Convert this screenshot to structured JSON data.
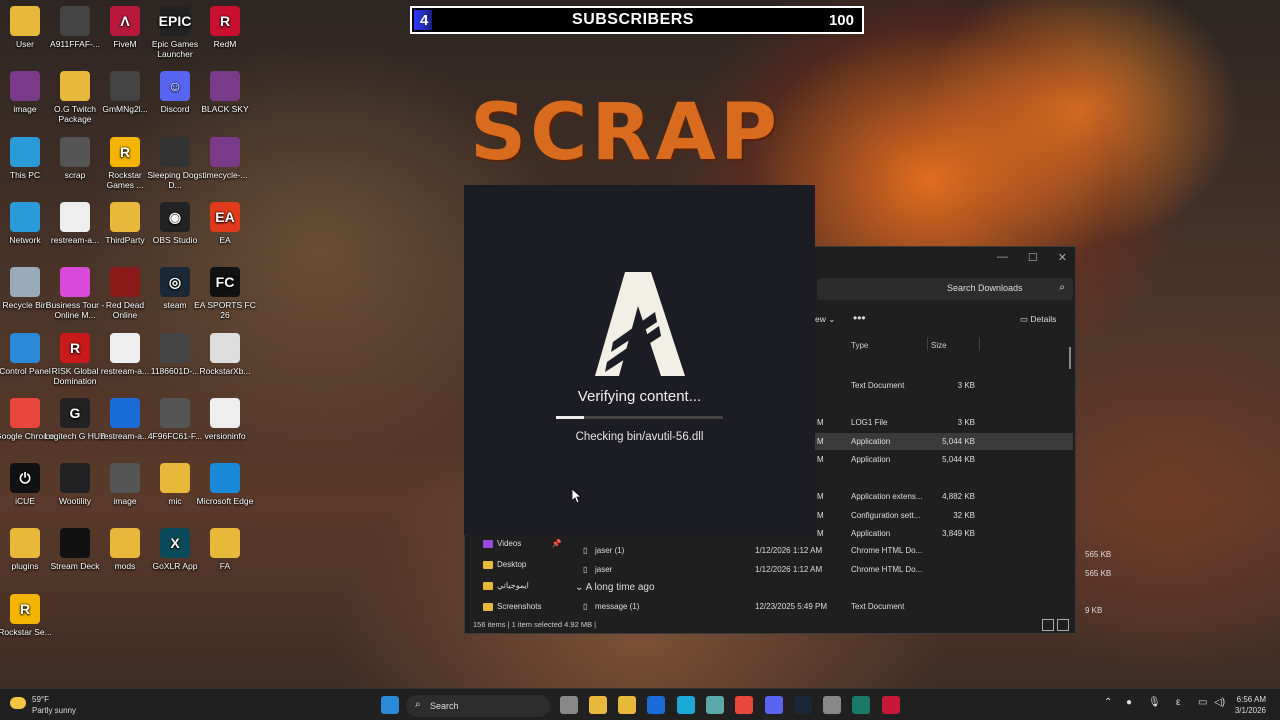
{
  "overlay": {
    "current": "4",
    "label": "SUBSCRIBERS",
    "goal": "100",
    "progress_fraction": 0.04,
    "bg_title": "SCRAP"
  },
  "desktop_icons": [
    {
      "label": "User",
      "color": "#e8b83a",
      "glyph": ""
    },
    {
      "label": "A911FFAF-...",
      "color": "#444",
      "glyph": ""
    },
    {
      "label": "FiveM",
      "color": "#b8183a",
      "glyph": "Λ"
    },
    {
      "label": "Epic Games Launcher",
      "color": "#222",
      "glyph": "EPIC"
    },
    {
      "label": "RedM",
      "color": "#c8102e",
      "glyph": "R"
    },
    {
      "label": "image",
      "color": "#7a3a8a",
      "glyph": ""
    },
    {
      "label": "O.G Twitch Package",
      "color": "#e8b83a",
      "glyph": ""
    },
    {
      "label": "GmMNg2l...",
      "color": "#444",
      "glyph": ""
    },
    {
      "label": "Discord",
      "color": "#5865f2",
      "glyph": "☺"
    },
    {
      "label": "BLACK SKY",
      "color": "#7a3a8a",
      "glyph": ""
    },
    {
      "label": "This PC",
      "color": "#2a9ad8",
      "glyph": ""
    },
    {
      "label": "scrap",
      "color": "#555",
      "glyph": ""
    },
    {
      "label": "Rockstar Games ...",
      "color": "#f4b400",
      "glyph": "R"
    },
    {
      "label": "Sleeping Dogs D...",
      "color": "#333",
      "glyph": ""
    },
    {
      "label": "timecycle-...",
      "color": "#7a3a8a",
      "glyph": ""
    },
    {
      "label": "Network",
      "color": "#2a9ad8",
      "glyph": ""
    },
    {
      "label": "restream-a...",
      "color": "#eee",
      "glyph": ""
    },
    {
      "label": "ThirdParty",
      "color": "#e8b83a",
      "glyph": ""
    },
    {
      "label": "OBS Studio",
      "color": "#222",
      "glyph": "◉"
    },
    {
      "label": "EA",
      "color": "#e03a1a",
      "glyph": "EA"
    },
    {
      "label": "Recycle Bin",
      "color": "#9ab",
      "glyph": ""
    },
    {
      "label": "Business Tour - Online M...",
      "color": "#d84ad8",
      "glyph": ""
    },
    {
      "label": "Red Dead Online",
      "color": "#8a1a1a",
      "glyph": ""
    },
    {
      "label": "steam",
      "color": "#1b2838",
      "glyph": "◎"
    },
    {
      "label": "EA SPORTS FC 26",
      "color": "#111",
      "glyph": "FC"
    },
    {
      "label": "Control Panel",
      "color": "#2a8ad8",
      "glyph": ""
    },
    {
      "label": "RISK Global Domination",
      "color": "#c81a1a",
      "glyph": "R"
    },
    {
      "label": "restream-a...",
      "color": "#eee",
      "glyph": ""
    },
    {
      "label": "1186601D-...",
      "color": "#444",
      "glyph": ""
    },
    {
      "label": "RockstarXb...",
      "color": "#ddd",
      "glyph": ""
    },
    {
      "label": "Google Chrome",
      "color": "#e8453c",
      "glyph": ""
    },
    {
      "label": "Logitech G HUB",
      "color": "#222",
      "glyph": "G"
    },
    {
      "label": "restream-a...",
      "color": "#1a6ad8",
      "glyph": ""
    },
    {
      "label": "4F96FC61-F...",
      "color": "#555",
      "glyph": ""
    },
    {
      "label": "versioninfo",
      "color": "#eee",
      "glyph": ""
    },
    {
      "label": "iCUE",
      "color": "#111",
      "glyph": "⏻"
    },
    {
      "label": "Wootility",
      "color": "#222",
      "glyph": ""
    },
    {
      "label": "image",
      "color": "#555",
      "glyph": ""
    },
    {
      "label": "mic",
      "color": "#e8b83a",
      "glyph": ""
    },
    {
      "label": "Microsoft Edge",
      "color": "#1a8ad8",
      "glyph": ""
    },
    {
      "label": "plugins",
      "color": "#e8b83a",
      "glyph": ""
    },
    {
      "label": "Stream Deck",
      "color": "#111",
      "glyph": ""
    },
    {
      "label": "mods",
      "color": "#e8b83a",
      "glyph": ""
    },
    {
      "label": "GoXLR App",
      "color": "#0a4a5a",
      "glyph": "X"
    },
    {
      "label": "FA",
      "color": "#e8b83a",
      "glyph": ""
    },
    {
      "label": "Rockstar Se...",
      "color": "#f4b400",
      "glyph": "R"
    }
  ],
  "explorer": {
    "search_placeholder": "Search Downloads",
    "view_label": "ew",
    "more_label": "•••",
    "details_label": "Details",
    "col_type": "Type",
    "col_size": "Size",
    "rows_top": [
      {
        "m": "",
        "type": "Text Document",
        "size": "3 KB"
      },
      {
        "m": "M",
        "type": "LOG1 File",
        "size": "3 KB"
      },
      {
        "m": "M",
        "type": "Application",
        "size": "5,044 KB",
        "selected": true
      },
      {
        "m": "M",
        "type": "Application",
        "size": "5,044 KB"
      },
      {
        "m": "M",
        "type": "Application extens...",
        "size": "4,882 KB"
      },
      {
        "m": "M",
        "type": "Configuration sett...",
        "size": "32 KB"
      },
      {
        "m": "M",
        "type": "Application",
        "size": "3,849 KB"
      }
    ],
    "rows_full": [
      {
        "name": "jaser (1)",
        "date": "1/12/2026 1:12 AM",
        "type": "Chrome HTML Do...",
        "size": "565 KB"
      },
      {
        "name": "jaser",
        "date": "1/12/2026 1:12 AM",
        "type": "Chrome HTML Do...",
        "size": "565 KB"
      }
    ],
    "group_label": "A long time ago",
    "row_last": {
      "name": "message (1)",
      "date": "12/23/2025 5:49 PM",
      "type": "Text Document",
      "size": "9 KB"
    },
    "nav": [
      {
        "label": "Videos"
      },
      {
        "label": "Desktop"
      },
      {
        "label": "ايموجياتي"
      },
      {
        "label": "Screenshots"
      }
    ],
    "status": "156 items  |  1 item selected  4.92 MB  |"
  },
  "loader": {
    "title": "Verifying content...",
    "checking": "Checking bin/avutil-56.dll",
    "progress_fraction": 0.17
  },
  "taskbar": {
    "temp": "59°F",
    "condition": "Partly sunny",
    "search_label": "Search",
    "time": "6:56 AM",
    "date": "3/1/2026",
    "apps": [
      {
        "name": "windows-start",
        "color": "#2a8ad8"
      },
      {
        "name": "task-view",
        "color": "#888"
      },
      {
        "name": "file-explorer",
        "color": "#e8b83a"
      },
      {
        "name": "ms-store",
        "color": "#e8b83a"
      },
      {
        "name": "outlook",
        "color": "#1a6ad8"
      },
      {
        "name": "edge",
        "color": "#1aa8d8"
      },
      {
        "name": "chrome-alt",
        "color": "#5aa8a8"
      },
      {
        "name": "chrome",
        "color": "#e8453c"
      },
      {
        "name": "discord",
        "color": "#5865f2"
      },
      {
        "name": "steam",
        "color": "#1b2838"
      },
      {
        "name": "obs",
        "color": "#888"
      },
      {
        "name": "goxlr",
        "color": "#1a7a6a"
      },
      {
        "name": "fivem",
        "color": "#c8183a"
      }
    ]
  }
}
